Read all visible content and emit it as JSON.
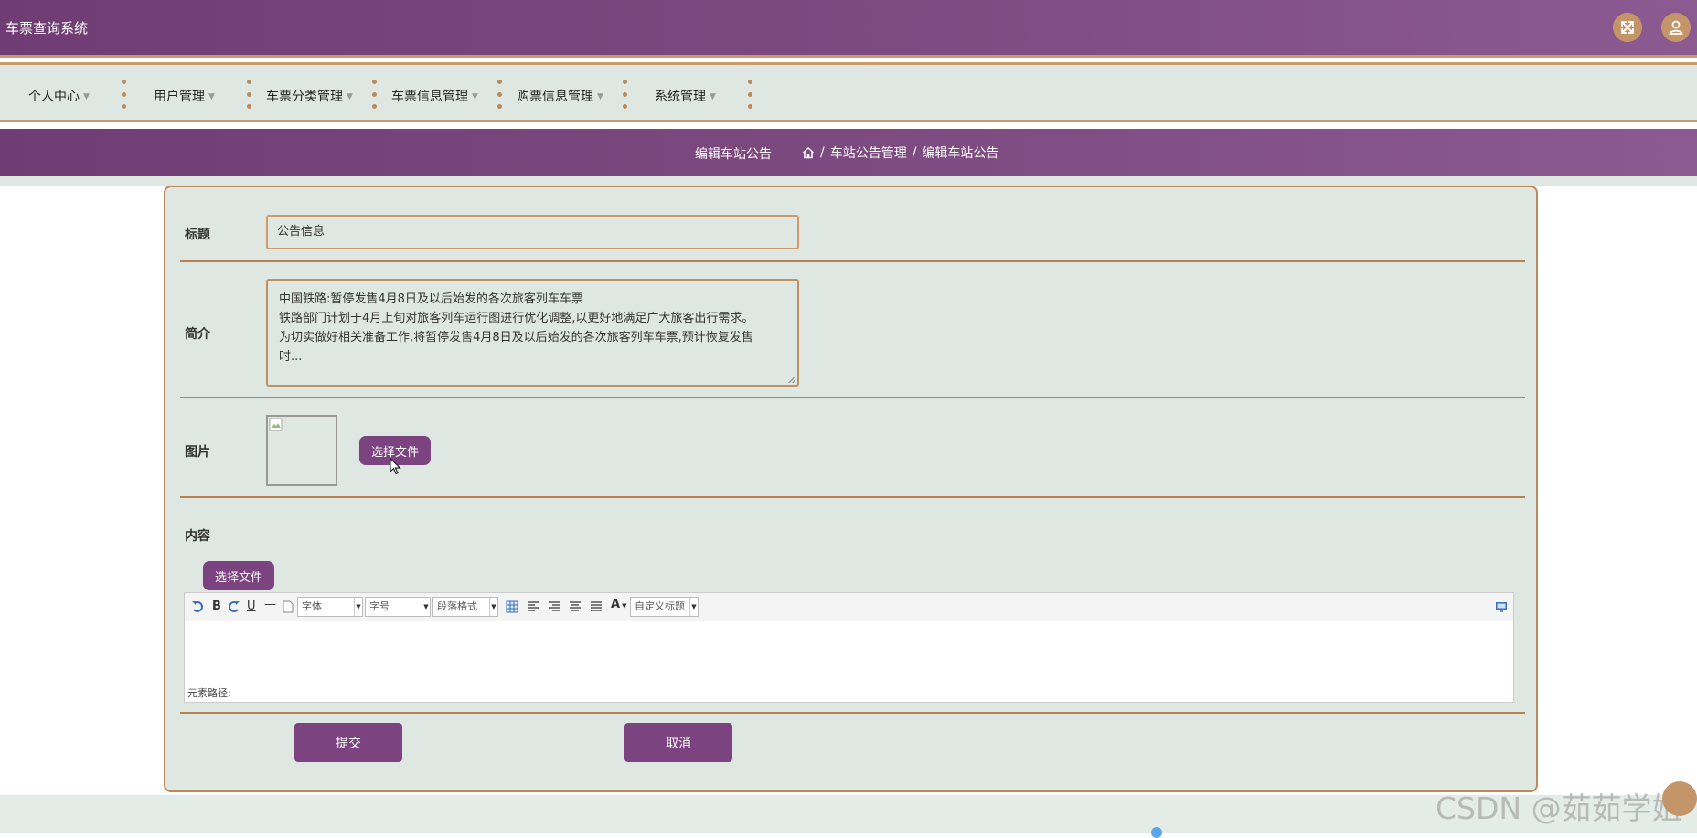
{
  "app": {
    "title": "车票查询系统"
  },
  "header": {
    "fullscreen_icon": "expand-icon",
    "user_icon": "user-icon"
  },
  "nav": {
    "items": [
      {
        "label": "个人中心"
      },
      {
        "label": "用户管理"
      },
      {
        "label": "车票分类管理"
      },
      {
        "label": "车票信息管理"
      },
      {
        "label": "购票信息管理"
      },
      {
        "label": "系统管理"
      }
    ]
  },
  "breadcrumb": {
    "page_title": "编辑车站公告",
    "home_icon": "home-icon",
    "separator": "/",
    "level1": "车站公告管理",
    "level2": "编辑车站公告"
  },
  "form": {
    "title_label": "标题",
    "title_value": "公告信息",
    "summary_label": "简介",
    "summary_lines": [
      "中国铁路:暂停发售4月8日及以后始发的各次旅客列车车票",
      "铁路部门计划于4月上旬对旅客列车运行图进行优化调整,以更好地满足广大旅客出行需求。",
      "为切实做好相关准备工作,将暂停发售4月8日及以后始发的各次旅客列车车票,预计恢复发售",
      "时..."
    ],
    "image_label": "图片",
    "choose_file": "选择文件",
    "content_label": "内容",
    "content_choose_file": "选择文件"
  },
  "editor": {
    "font_family": "字体",
    "font_size": "字号",
    "paragraph": "段落格式",
    "custom_title": "自定义标题",
    "bold": "B",
    "italic": "I",
    "underline": "U",
    "font_color": "A",
    "element_path": "元素路径:"
  },
  "actions": {
    "submit": "提交",
    "cancel": "取消"
  },
  "watermark": "CSDN @茹茹学姐"
}
